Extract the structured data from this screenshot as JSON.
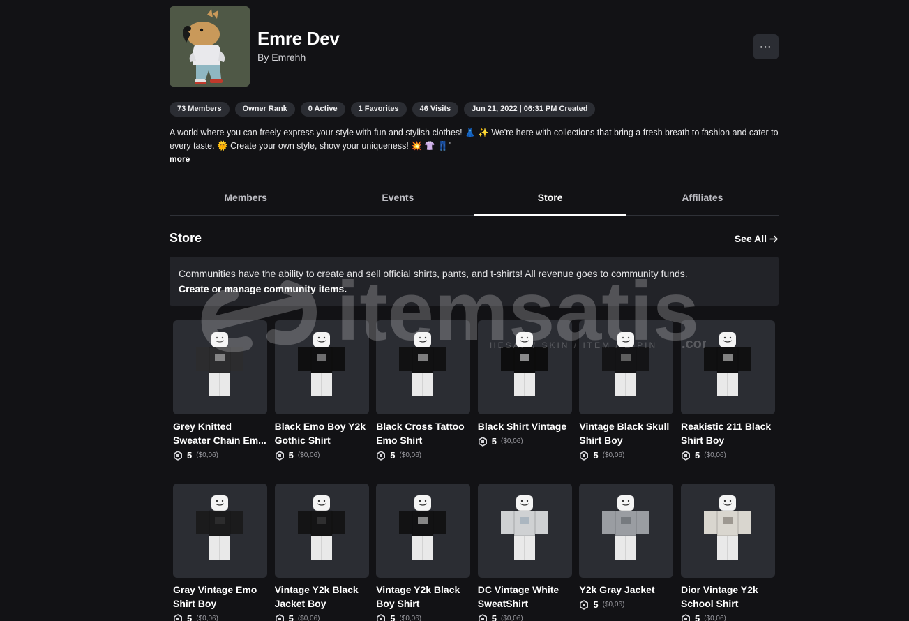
{
  "group": {
    "name": "Emre Dev",
    "owner": "By Emrehh",
    "more_label": "···"
  },
  "stats": [
    "73 Members",
    "Owner Rank",
    "0 Active",
    "1 Favorites",
    "46 Visits",
    "Jun 21, 2022 | 06:31 PM Created"
  ],
  "description": {
    "text": "A world where you can freely express your style with fun and stylish clothes! 👗 ✨ We're here with collections that bring a fresh breath to fashion and cater to every taste. 🌞 Create your own style, show your uniqueness! 💥 👚 👖\"",
    "more_label": "more"
  },
  "tabs": [
    {
      "label": "Members",
      "active": false
    },
    {
      "label": "Events",
      "active": false
    },
    {
      "label": "Store",
      "active": true
    },
    {
      "label": "Affiliates",
      "active": false
    }
  ],
  "store": {
    "title": "Store",
    "see_all": "See All",
    "info_text": "Communities have the ability to create and sell official shirts, pants, and t-shirts! All revenue goes to community funds.",
    "manage_link": "Create or manage community items."
  },
  "items": [
    {
      "name": "Grey Knitted Sweater Chain Em...",
      "price": "5",
      "usd": "($0,06)",
      "shirt": "#2c2c2e",
      "accent": "#cfcfcf"
    },
    {
      "name": "Black Emo Boy Y2k Gothic Shirt",
      "price": "5",
      "usd": "($0,06)",
      "shirt": "#0f0f10",
      "accent": "#bdbdbd"
    },
    {
      "name": "Black Cross Tattoo Emo Shirt",
      "price": "5",
      "usd": "($0,06)",
      "shirt": "#111112",
      "accent": "#d8d8d8"
    },
    {
      "name": "Black Shirt Vintage",
      "price": "5",
      "usd": "($0,06)",
      "shirt": "#0d0d0e",
      "accent": "#f2f2f2"
    },
    {
      "name": "Vintage Black Skull Shirt Boy",
      "price": "5",
      "usd": "($0,06)",
      "shirt": "#141416",
      "accent": "#9a9a9a"
    },
    {
      "name": "Reakistic 211 Black Shirt Boy",
      "price": "5",
      "usd": "($0,06)",
      "shirt": "#101011",
      "accent": "#e0e0e0"
    },
    {
      "name": "Gray Vintage Emo Shirt Boy",
      "price": "5",
      "usd": "($0,06)",
      "shirt": "#1b1b1c",
      "accent": "#3a3a3c"
    },
    {
      "name": "Vintage Y2k Black Jacket Boy",
      "price": "5",
      "usd": "($0,06)",
      "shirt": "#141415",
      "accent": "#444446"
    },
    {
      "name": "Vintage Y2k Black Boy Shirt",
      "price": "5",
      "usd": "($0,06)",
      "shirt": "#121213",
      "accent": "#e6e6e6"
    },
    {
      "name": "DC Vintage White SweatShirt",
      "price": "5",
      "usd": "($0,06)",
      "shirt": "#cfd1d3",
      "accent": "#8ea0b0"
    },
    {
      "name": "Y2k Gray Jacket",
      "price": "5",
      "usd": "($0,06)",
      "shirt": "#9a9da2",
      "accent": "#5a5d62"
    },
    {
      "name": "Dior Vintage Y2k School Shirt",
      "price": "5",
      "usd": "($0,06)",
      "shirt": "#d9d6cf",
      "accent": "#6b665e"
    }
  ],
  "watermark": {
    "brand": "itemsatis",
    "tagline": "HESAP / SKIN / ITEM / E-PIN",
    "suffix": ".com"
  },
  "colors": {
    "background": "#121215",
    "card": "#2b2d33",
    "pill": "#2b2d33",
    "info_box": "#222328"
  }
}
